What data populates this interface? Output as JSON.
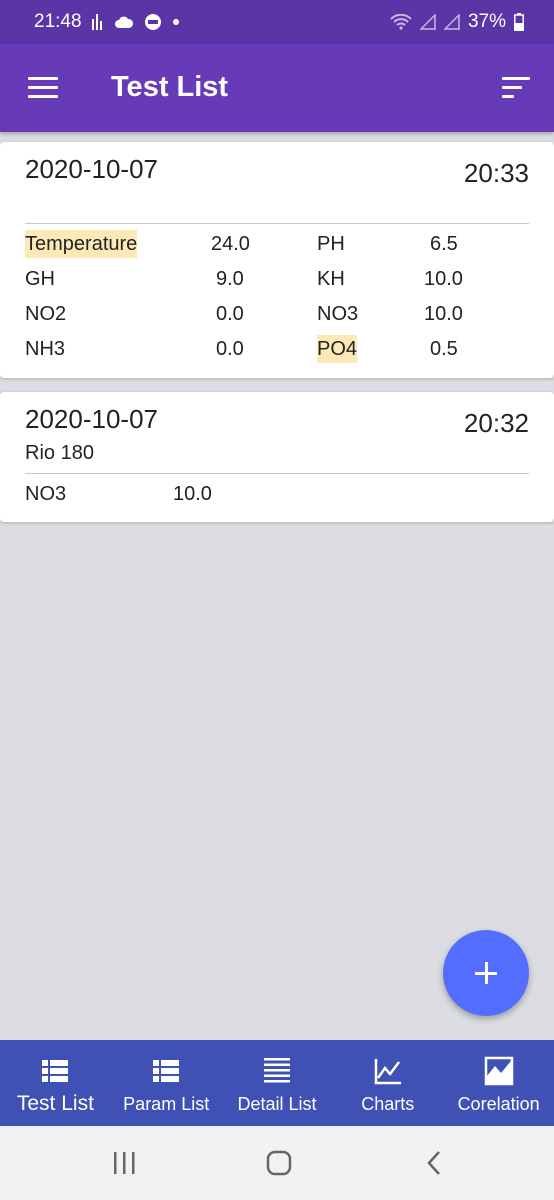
{
  "status_bar": {
    "time": "21:48",
    "battery": "37%"
  },
  "app_bar": {
    "title": "Test List",
    "menu_icon": "hamburger-menu-icon",
    "sort_icon": "sort-icon"
  },
  "tests": [
    {
      "date": "2020-10-07",
      "time": "20:33",
      "name": "",
      "params": [
        {
          "label": "Temperature",
          "value": "24.0",
          "highlight": true
        },
        {
          "label": "PH",
          "value": "6.5",
          "highlight": false
        },
        {
          "label": "GH",
          "value": "9.0",
          "highlight": false
        },
        {
          "label": "KH",
          "value": "10.0",
          "highlight": false
        },
        {
          "label": "NO2",
          "value": "0.0",
          "highlight": false
        },
        {
          "label": "NO3",
          "value": "10.0",
          "highlight": false
        },
        {
          "label": "NH3",
          "value": "0.0",
          "highlight": false
        },
        {
          "label": "PO4",
          "value": "0.5",
          "highlight": true
        }
      ]
    },
    {
      "date": "2020-10-07",
      "time": "20:32",
      "name": "Rio 180",
      "params": [
        {
          "label": "NO3",
          "value": "10.0",
          "highlight": false
        }
      ]
    }
  ],
  "fab": {
    "icon": "plus-icon"
  },
  "bottom_nav": [
    {
      "label": "Test List",
      "icon": "list-icon",
      "active": true
    },
    {
      "label": "Param List",
      "icon": "list-icon",
      "active": false
    },
    {
      "label": "Detail List",
      "icon": "lines-icon",
      "active": false
    },
    {
      "label": "Charts",
      "icon": "line-chart-icon",
      "active": false
    },
    {
      "label": "Corelation",
      "icon": "area-chart-icon",
      "active": false
    }
  ],
  "colors": {
    "status_bar": "#5b34a6",
    "app_bar": "#673ab7",
    "bottom_nav": "#3f51b5",
    "fab": "#536dfe",
    "highlight": "#fde9b8",
    "background": "#dcdde2"
  }
}
